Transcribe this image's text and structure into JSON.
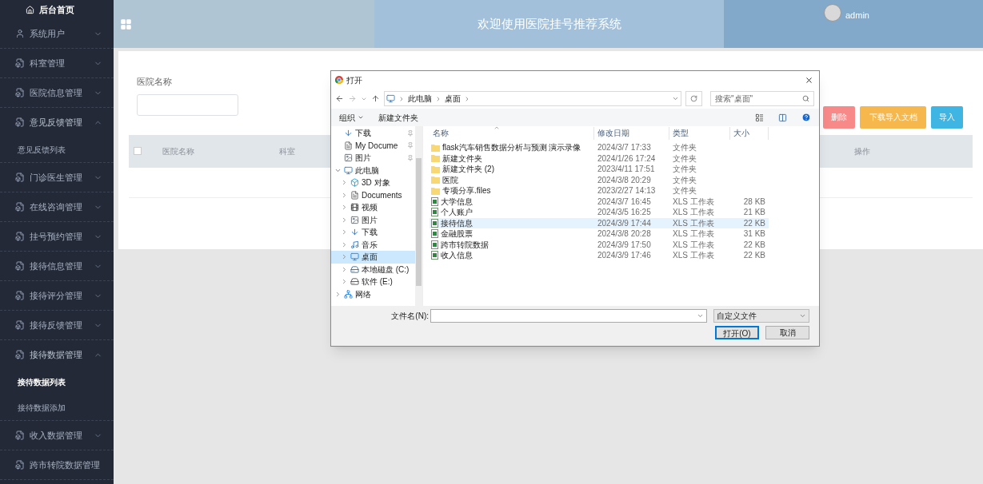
{
  "sidebar": {
    "home": "后台首页",
    "items": [
      {
        "label": "系统用户",
        "expanded": false
      },
      {
        "label": "科室管理",
        "expanded": false
      },
      {
        "label": "医院信息管理",
        "expanded": false
      },
      {
        "label": "意见反馈管理",
        "expanded": true,
        "children": [
          {
            "label": "意见反馈列表",
            "selected": false
          }
        ]
      },
      {
        "label": "门诊医生管理",
        "expanded": false
      },
      {
        "label": "在线咨询管理",
        "expanded": false
      },
      {
        "label": "挂号预约管理",
        "expanded": false
      },
      {
        "label": "接待信息管理",
        "expanded": false
      },
      {
        "label": "接待评分管理",
        "expanded": false
      },
      {
        "label": "接待反馈管理",
        "expanded": false
      },
      {
        "label": "接待数据管理",
        "expanded": true,
        "children": [
          {
            "label": "接待数据列表",
            "selected": true
          },
          {
            "label": "接待数据添加",
            "selected": false
          }
        ]
      },
      {
        "label": "收入数据管理",
        "expanded": false
      },
      {
        "label": "跨市转院数据管理",
        "expanded": false
      }
    ]
  },
  "header": {
    "title": "欢迎使用医院挂号推荐系统",
    "user": "admin"
  },
  "search": {
    "label": "医院名称"
  },
  "buttons": [
    {
      "label": "删除",
      "kind": "danger"
    },
    {
      "label": "下载导入文档",
      "kind": "warning"
    },
    {
      "label": "导入",
      "kind": "primary"
    }
  ],
  "table": {
    "select_all": false,
    "columns": [
      "医院名称",
      "科室",
      "操作"
    ]
  },
  "dialog": {
    "title": "打开",
    "breadcrumb": [
      "此电脑",
      "桌面"
    ],
    "search_placeholder": "搜索\"桌面\"",
    "organize": "组织",
    "new_folder": "新建文件夹",
    "nav": [
      {
        "label": "下载",
        "kind": "download",
        "pinned": true
      },
      {
        "label": "My Docume",
        "kind": "document",
        "pinned": true
      },
      {
        "label": "图片",
        "kind": "picture",
        "pinned": true
      },
      {
        "label": "此电脑",
        "kind": "pc",
        "expanded": true,
        "selected": false,
        "children": [
          {
            "label": "3D 对象",
            "kind": "objects",
            "expanded": false,
            "selected": false
          },
          {
            "label": "Documents",
            "kind": "document",
            "expanded": false,
            "selected": false
          },
          {
            "label": "视频",
            "kind": "video",
            "expanded": false,
            "selected": false
          },
          {
            "label": "图片",
            "kind": "picture",
            "expanded": false,
            "selected": false
          },
          {
            "label": "下载",
            "kind": "download",
            "expanded": false,
            "selected": false
          },
          {
            "label": "音乐",
            "kind": "music",
            "expanded": false,
            "selected": false
          },
          {
            "label": "桌面",
            "kind": "desktop",
            "expanded": false,
            "selected": true
          },
          {
            "label": "本地磁盘 (C:)",
            "kind": "system-drive",
            "expanded": false,
            "selected": false
          },
          {
            "label": "软件 (E:)",
            "kind": "drive",
            "expanded": false,
            "selected": false
          }
        ]
      },
      {
        "label": "网络",
        "kind": "network",
        "expanded": false,
        "selected": false
      }
    ],
    "columns": [
      "名称",
      "修改日期",
      "类型",
      "大小"
    ],
    "files": [
      {
        "name": "flask汽车销售数据分析与预测 演示录像",
        "date": "2024/3/7 17:33",
        "type": "文件夹",
        "kind": "folder",
        "selected": false
      },
      {
        "name": "新建文件夹",
        "date": "2024/1/26 17:24",
        "type": "文件夹",
        "kind": "folder",
        "selected": false
      },
      {
        "name": "新建文件夹 (2)",
        "date": "2023/4/11 17:51",
        "type": "文件夹",
        "kind": "folder",
        "selected": false
      },
      {
        "name": "医院",
        "date": "2024/3/8 20:29",
        "type": "文件夹",
        "kind": "folder",
        "selected": false
      },
      {
        "name": "专项分享.files",
        "date": "2023/2/27 14:13",
        "type": "文件夹",
        "kind": "folder",
        "selected": false
      },
      {
        "name": "大学信息",
        "date": "2024/3/7 16:45",
        "type": "XLS 工作表",
        "size": "28 KB",
        "kind": "xls",
        "selected": false
      },
      {
        "name": "个人账户",
        "date": "2024/3/5 16:25",
        "type": "XLS 工作表",
        "size": "21 KB",
        "kind": "xls",
        "selected": false
      },
      {
        "name": "接待信息",
        "date": "2024/3/9 17:44",
        "type": "XLS 工作表",
        "size": "22 KB",
        "kind": "xls",
        "selected": true
      },
      {
        "name": "金融股票",
        "date": "2024/3/8 20:28",
        "type": "XLS 工作表",
        "size": "31 KB",
        "kind": "xls",
        "selected": false
      },
      {
        "name": "跨市转院数据",
        "date": "2024/3/9 17:50",
        "type": "XLS 工作表",
        "size": "22 KB",
        "kind": "xls",
        "selected": false
      },
      {
        "name": "收入信息",
        "date": "2024/3/9 17:46",
        "type": "XLS 工作表",
        "size": "22 KB",
        "kind": "xls",
        "selected": false
      }
    ],
    "filename_label": "文件名(N):",
    "filter": "自定义文件",
    "open": "打开(O)",
    "cancel": "取消"
  }
}
